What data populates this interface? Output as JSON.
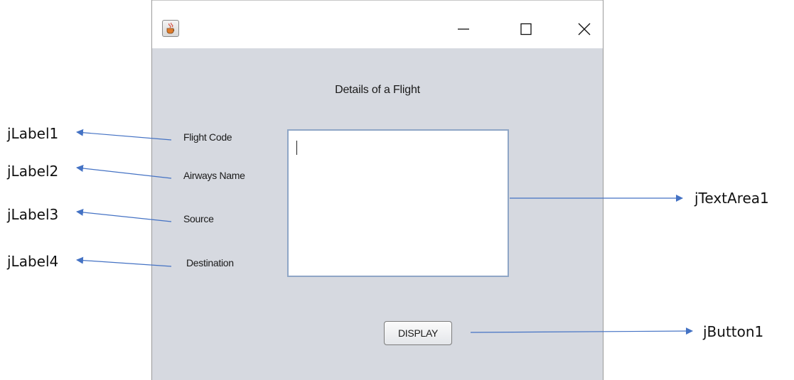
{
  "window": {
    "icon": "java-cup-icon",
    "controls": {
      "minimize": "minimize-icon",
      "maximize": "maximize-icon",
      "close": "close-icon"
    }
  },
  "form": {
    "title": "Details of a Flight",
    "labels": [
      "Flight Code",
      "Airways Name",
      "Source",
      "Destination"
    ],
    "text_area_value": "",
    "button_label": "DISPLAY"
  },
  "callouts": {
    "label1": "jLabel1",
    "label2": "jLabel2",
    "label3": "jLabel3",
    "label4": "jLabel4",
    "text_area": "jTextArea1",
    "button": "jButton1"
  },
  "colors": {
    "window_bg": "#d6d9e0",
    "arrow": "#4472c4",
    "text_area_border": "#8fa6c6"
  }
}
